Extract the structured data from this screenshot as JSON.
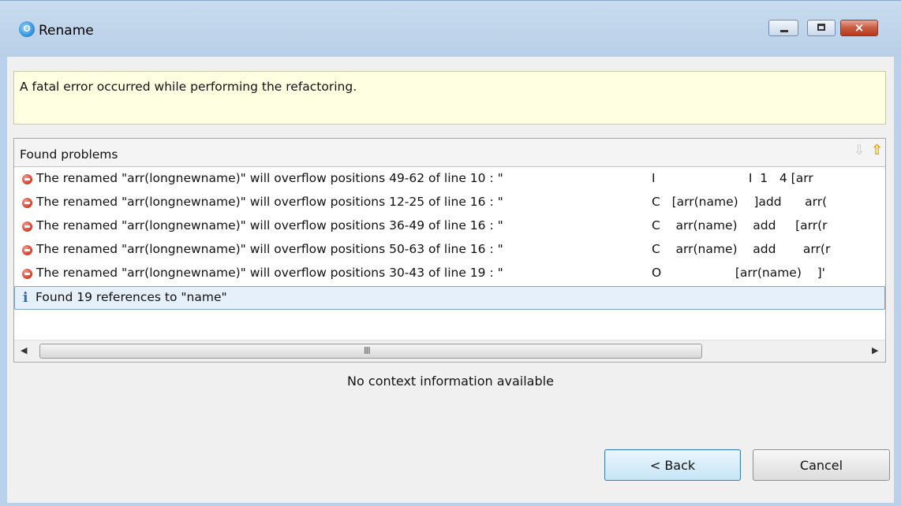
{
  "window": {
    "title": "Rename",
    "close_glyph": "×"
  },
  "message": "A fatal error occurred while performing the refactoring.",
  "problems": {
    "title": "Found problems",
    "next_icon": "⇩",
    "prev_icon": "⇧",
    "rows": [
      {
        "type": "error",
        "message": "The renamed \"arr(longnewname)\" will overflow positions 49-62 of line 10 : \"",
        "context": "I                        I  1   4 [arr"
      },
      {
        "type": "error",
        "message": "The renamed \"arr(longnewname)\" will overflow positions 12-25 of line 16 : \"",
        "context": "C   [arr(name)    ]add      arr("
      },
      {
        "type": "error",
        "message": "The renamed \"arr(longnewname)\" will overflow positions 36-49 of line 16 : \"",
        "context": "C    arr(name)    add     [arr(r"
      },
      {
        "type": "error",
        "message": "The renamed \"arr(longnewname)\" will overflow positions 50-63 of line 16 : \"",
        "context": "C    arr(name)    add       arr(r"
      },
      {
        "type": "error",
        "message": "The renamed \"arr(longnewname)\" will overflow positions 30-43 of line 19 : \"",
        "context": "O                   [arr(name)    ]'"
      }
    ],
    "info_row": {
      "type": "info",
      "icon": "i",
      "message": "Found 19 references to \"name\""
    },
    "scrollbar": {
      "left_arrow": "◀",
      "right_arrow": "▶",
      "grip": "III"
    }
  },
  "context_info": "No context information available",
  "buttons": {
    "back": "< Back",
    "cancel": "Cancel"
  }
}
